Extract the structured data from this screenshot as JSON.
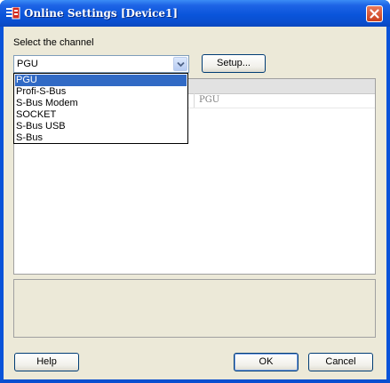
{
  "window": {
    "title": "Online Settings [Device1]"
  },
  "channel": {
    "label": "Select the channel",
    "selected": "PGU",
    "options": [
      "PGU",
      "Profi-S-Bus",
      "S-Bus Modem",
      "SOCKET",
      "S-Bus USB",
      "S-Bus"
    ]
  },
  "buttons": {
    "setup": "Setup...",
    "help": "Help",
    "ok": "OK",
    "cancel": "Cancel"
  },
  "settings_table": {
    "row_value": "PGU"
  },
  "colors": {
    "title_bar": "#0a55db",
    "selection": "#316ac5",
    "dialog_bg": "#ece9d8"
  },
  "icons": {
    "title": "device-settings-icon",
    "close": "close-icon",
    "dropdown": "chevron-down-icon"
  }
}
